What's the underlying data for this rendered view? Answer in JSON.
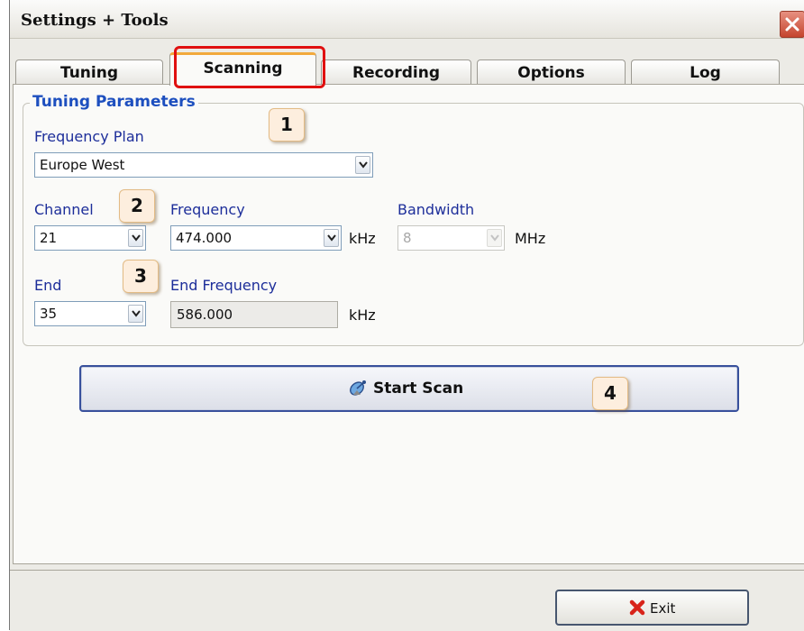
{
  "window": {
    "title": "Settings + Tools"
  },
  "tabs": [
    {
      "label": "Tuning",
      "active": false
    },
    {
      "label": "Scanning",
      "active": true
    },
    {
      "label": "Recording",
      "active": false
    },
    {
      "label": "Options",
      "active": false
    },
    {
      "label": "Log",
      "active": false
    }
  ],
  "group": {
    "legend": "Tuning Parameters"
  },
  "frequency_plan": {
    "label": "Frequency Plan",
    "value": "Europe West"
  },
  "channel": {
    "label": "Channel",
    "value": "21"
  },
  "frequency": {
    "label": "Frequency",
    "value": "474.000",
    "unit": "kHz"
  },
  "bandwidth": {
    "label": "Bandwidth",
    "value": "8",
    "unit": "MHz",
    "enabled": false
  },
  "end": {
    "label": "End",
    "value": "35"
  },
  "end_frequency": {
    "label": "End Frequency",
    "value": "586.000",
    "unit": "kHz"
  },
  "start_scan": {
    "label": "Start Scan"
  },
  "exit": {
    "label": "Exit"
  },
  "callouts": [
    "1",
    "2",
    "3",
    "4"
  ],
  "colors": {
    "accent_label": "#1d2e9a",
    "legend": "#1d4fbf",
    "highlight": "#e01010",
    "active_tab_top": "#f2a93c"
  },
  "icons": {
    "close": "close-icon",
    "scan": "satellite-dish-icon",
    "exit": "red-x-icon",
    "dropdown": "chevron-down-icon"
  }
}
